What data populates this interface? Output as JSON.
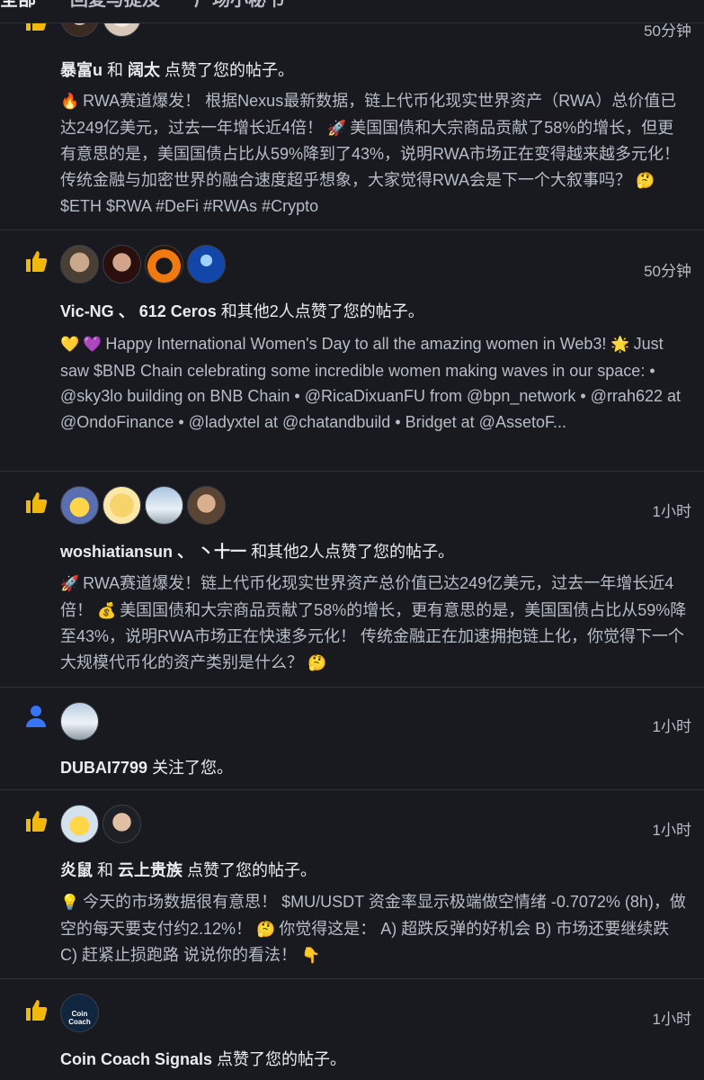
{
  "tabs": [
    "全部",
    "回复与提及",
    "广场小秘书"
  ],
  "notifications": [
    {
      "time": "50分钟",
      "user1": "暴富u",
      "connector": "和",
      "user2": "阔太",
      "action": "点赞了您的帖子。",
      "emoji1": "🔥",
      "body": "RWA赛道爆发！ 根据Nexus最新数据，链上代币化现实世界资产（RWA）总价值已达249亿美元，过去一年增长近4倍！",
      "emoji2": "🚀",
      "body2": "美国国债和大宗商品贡献了58%的增长，但更有意思的是，美国国债占比从59%降到了43%，说明RWA市场正在变得越来越多元化！ 传统金融与加密世界的融合速度超乎想象，大家觉得RWA会是下一个大叙事吗？",
      "emoji3": "🤔",
      "tags": "$ETH $RWA #DeFi #RWAs #Crypto"
    },
    {
      "time": "50分钟",
      "user1": "Vic-NG",
      "sep": "、",
      "user2": "612 Ceros",
      "action": "和其他2人点赞了您的帖子。",
      "emoji1": "💛",
      "emoji2": "💜",
      "body": "Happy International Women's Day to all the amazing women in Web3!",
      "emoji3": "🌟",
      "body2": "Just saw $BNB Chain celebrating some incredible women making waves in our space: • @sky3lo building on BNB Chain • @RicaDixuanFU from @bpn_network • @rrah622 at @OndoFinance • @ladyxtel at @chatandbuild • Bridget at @AssetoF..."
    },
    {
      "time": "1小时",
      "user1": "woshiatiansun",
      "sep": "、",
      "user2": "丶十一",
      "action": "和其他2人点赞了您的帖子。",
      "emoji1": "🚀",
      "body": "RWA赛道爆发！链上代币化现实世界资产总价值已达249亿美元，过去一年增长近4倍！",
      "emoji2": "💰",
      "body2": "美国国债和大宗商品贡献了58%的增长，更有意思的是，美国国债占比从59%降至43%，说明RWA市场正在快速多元化！ 传统金融正在加速拥抱链上化，你觉得下一个大规模代币化的资产类别是什么？",
      "emoji3": "🤔"
    },
    {
      "time": "1小时",
      "user1": "DUBAI7799",
      "action": "关注了您。"
    },
    {
      "time": "1小时",
      "user1": "炎鼠",
      "connector": "和",
      "user2": "云上贵族",
      "action": "点赞了您的帖子。",
      "emoji1": "💡",
      "body": "今天的市场数据很有意思！ $MU/USDT 资金率显示极端做空情绪 -0.7072% (8h)，做空的每天要支付约2.12%！",
      "emoji2": "🤔",
      "body2": "你觉得这是： A) 超跌反弹的好机会 B) 市场还要继续跌 C) 赶紧止损跑路 说说你的看法！",
      "emoji3": "👇"
    },
    {
      "time": "1小时",
      "user1": "Coin Coach Signals",
      "action": "点赞了您的帖子。",
      "avatar_text": "Coin Coach"
    }
  ],
  "colors": {
    "background": "#181a20",
    "divider": "#2b3139",
    "like_icon": "#f0b90b",
    "follow_icon": "#3875f6",
    "muted_text": "#b7bdc6"
  },
  "icons": {
    "like": "thumbs-up-icon",
    "follow": "person-icon"
  }
}
